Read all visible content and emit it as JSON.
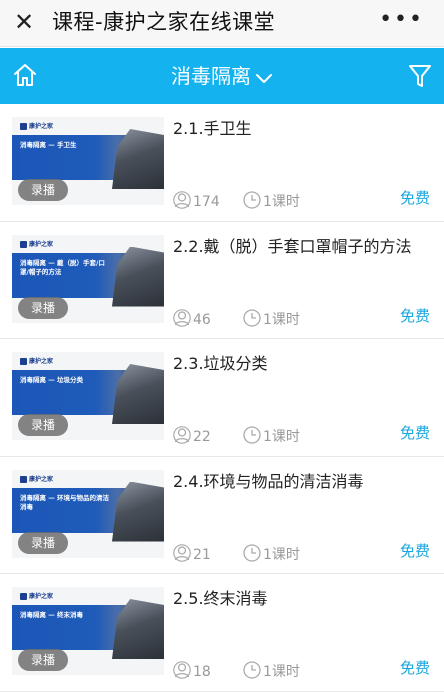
{
  "titlebar": {
    "close_glyph": "✕",
    "title": "课程-康护之家在线课堂",
    "more_glyph": "•••"
  },
  "navbar": {
    "category": "消毒隔离",
    "home_icon": "home-icon",
    "filter_icon": "filter-icon",
    "accent": "#14b3ef"
  },
  "courses": [
    {
      "thumb_logo": "康护之家",
      "thumb_title": "消毒隔离 — 手卫生",
      "badge": "录播",
      "title": "2.1.手卫生",
      "views": "174",
      "hours": "1课时",
      "price": "免费"
    },
    {
      "thumb_logo": "康护之家",
      "thumb_title": "消毒隔离 — 戴（脱）手套/口罩/帽子的方法",
      "badge": "录播",
      "title": "2.2.戴（脱）手套口罩帽子的方法",
      "views": "46",
      "hours": "1课时",
      "price": "免费"
    },
    {
      "thumb_logo": "康护之家",
      "thumb_title": "消毒隔离 — 垃圾分类",
      "badge": "录播",
      "title": "2.3.垃圾分类",
      "views": "22",
      "hours": "1课时",
      "price": "免费"
    },
    {
      "thumb_logo": "康护之家",
      "thumb_title": "消毒隔离 — 环境与物品的清洁消毒",
      "badge": "录播",
      "title": "2.4.环境与物品的清洁消毒",
      "views": "21",
      "hours": "1课时",
      "price": "免费"
    },
    {
      "thumb_logo": "康护之家",
      "thumb_title": "消毒隔离 — 终末消毒",
      "badge": "录播",
      "title": "2.5.终末消毒",
      "views": "18",
      "hours": "1课时",
      "price": "免费"
    }
  ]
}
